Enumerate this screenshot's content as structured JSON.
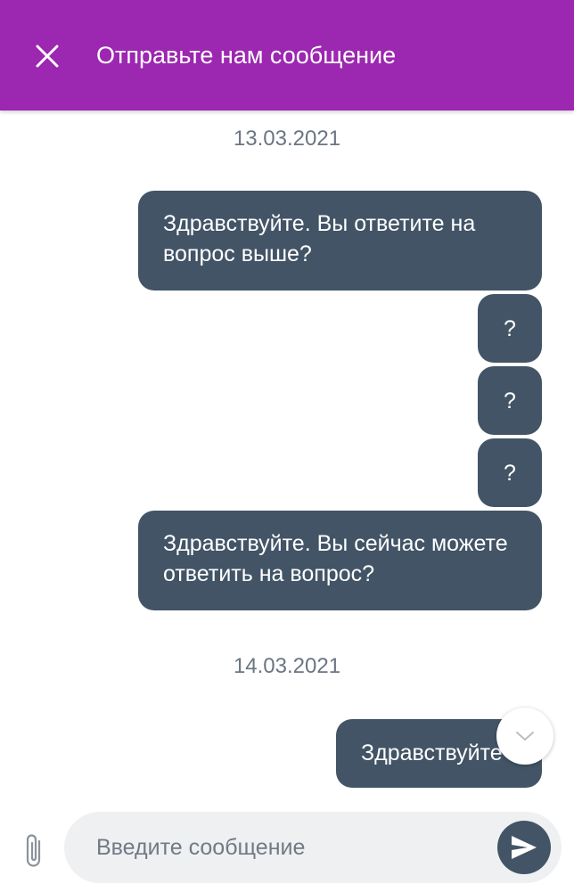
{
  "header": {
    "title": "Отправьте нам сообщение",
    "close_icon": "close-icon"
  },
  "chat": {
    "date_1": "13.03.2021",
    "date_2": "14.03.2021",
    "messages": [
      {
        "text": "Здравствуйте. Вы ответите на вопрос выше?"
      },
      {
        "text": "?"
      },
      {
        "text": "?"
      },
      {
        "text": "?"
      },
      {
        "text": "Здравствуйте. Вы сейчас можете ответить на вопрос?"
      },
      {
        "text": "Здравствуйте"
      }
    ],
    "scroll_icon": "chevron-down-icon"
  },
  "composer": {
    "placeholder": "Введите сообщение",
    "value": "",
    "attach_icon": "paperclip-icon",
    "send_icon": "send-icon"
  },
  "colors": {
    "header_bg": "#9c27b0",
    "bubble_bg": "#425466",
    "date_text": "#6b7582",
    "input_bg": "#eff0f2"
  }
}
